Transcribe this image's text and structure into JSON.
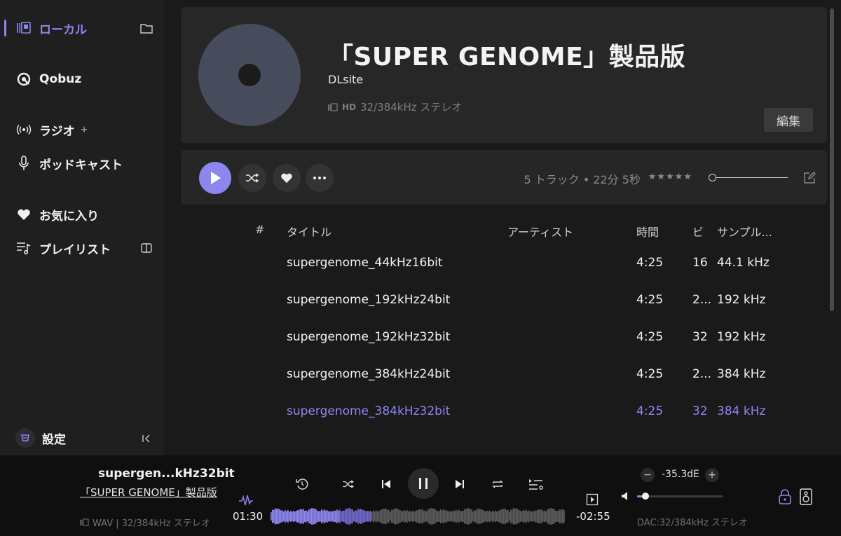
{
  "sidebar": {
    "local_label": "ローカル",
    "qobuz_label": "Qobuz",
    "radio_label": "ラジオ",
    "radio_plus": "+",
    "podcast_label": "ポッドキャスト",
    "favorites_label": "お気に入り",
    "playlist_label": "プレイリスト",
    "settings_label": "設定"
  },
  "album": {
    "title": "「SUPER GENOME」製品版",
    "artist": "DLsite",
    "hd_badge": "HD",
    "quality": "32/384kHz ステレオ",
    "edit_label": "編集",
    "summary": "5 トラック • 22分 5秒",
    "rating_stars": "★★★★★"
  },
  "table": {
    "headers": {
      "num": "#",
      "title": "タイトル",
      "artist": "アーティスト",
      "time": "時間",
      "bit": "ビ",
      "rate": "サンプル..."
    },
    "rows": [
      {
        "title": "supergenome_44kHz16bit",
        "artist": "",
        "time": "4:25",
        "bit": "16",
        "rate": "44.1 kHz"
      },
      {
        "title": "supergenome_192kHz24bit",
        "artist": "",
        "time": "4:25",
        "bit": "2...",
        "rate": "192 kHz"
      },
      {
        "title": "supergenome_192kHz32bit",
        "artist": "",
        "time": "4:25",
        "bit": "32",
        "rate": "192 kHz"
      },
      {
        "title": "supergenome_384kHz24bit",
        "artist": "",
        "time": "4:25",
        "bit": "2...",
        "rate": "384 kHz"
      },
      {
        "title": "supergenome_384kHz32bit",
        "artist": "",
        "time": "4:25",
        "bit": "32",
        "rate": "384 kHz"
      }
    ],
    "playing_index": 4
  },
  "player": {
    "track_title": "supergen...kHz32bit",
    "album": "「SUPER GENOME」製品版",
    "format": "WAV | 32/384kHz ステレオ",
    "elapsed": "01:30",
    "remaining": "-02:55",
    "progress": 0.34,
    "volume_db": "-35.3dE",
    "volume_level": 0.1,
    "vol_minus": "−",
    "vol_plus": "+",
    "dac": "DAC:32/384kHz ステレオ"
  },
  "colors": {
    "accent": "#8d86ee",
    "background": "#1a1a1a",
    "sidebar": "#1f1f1f",
    "card": "#272727",
    "player_bar": "#0f0f0f"
  }
}
